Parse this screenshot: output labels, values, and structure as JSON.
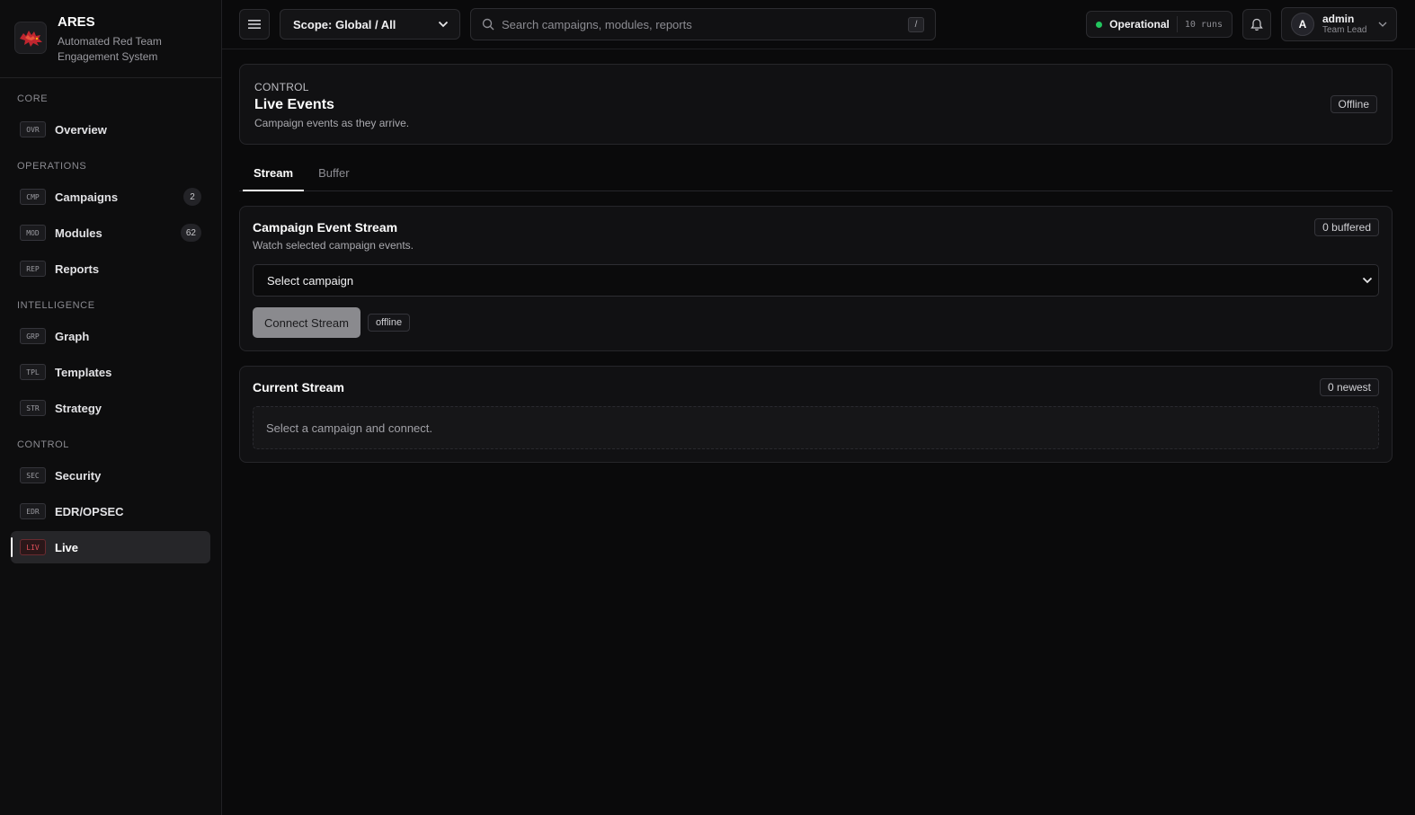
{
  "brand": {
    "name": "ARES",
    "subtitle_line1": "Automated Red Team",
    "subtitle_line2": "Engagement System"
  },
  "sidebar": {
    "sections": [
      {
        "title": "CORE",
        "items": [
          {
            "code": "OVR",
            "label": "Overview"
          }
        ]
      },
      {
        "title": "OPERATIONS",
        "items": [
          {
            "code": "CMP",
            "label": "Campaigns",
            "count": "2"
          },
          {
            "code": "MOD",
            "label": "Modules",
            "count": "62"
          },
          {
            "code": "REP",
            "label": "Reports"
          }
        ]
      },
      {
        "title": "INTELLIGENCE",
        "items": [
          {
            "code": "GRP",
            "label": "Graph"
          },
          {
            "code": "TPL",
            "label": "Templates"
          },
          {
            "code": "STR",
            "label": "Strategy"
          }
        ]
      },
      {
        "title": "CONTROL",
        "items": [
          {
            "code": "SEC",
            "label": "Security"
          },
          {
            "code": "EDR",
            "label": "EDR/OPSEC"
          },
          {
            "code": "LIV",
            "label": "Live",
            "active": true
          }
        ]
      }
    ]
  },
  "topbar": {
    "scope_label": "Scope: Global / All",
    "search_placeholder": "Search campaigns, modules, reports",
    "search_shortcut": "/",
    "status_label": "Operational",
    "status_runs": "10 runs",
    "user_initial": "A",
    "user_name": "admin",
    "user_role": "Team Lead"
  },
  "page": {
    "eyebrow": "CONTROL",
    "title": "Live Events",
    "description": "Campaign events as they arrive.",
    "status_badge": "Offline"
  },
  "tabs": [
    {
      "label": "Stream",
      "active": true
    },
    {
      "label": "Buffer",
      "active": false
    }
  ],
  "event_stream": {
    "title": "Campaign Event Stream",
    "description": "Watch selected campaign events.",
    "badge": "0 buffered",
    "select_value": "Select campaign",
    "connect_label": "Connect Stream",
    "connection_state": "offline"
  },
  "current_stream": {
    "title": "Current Stream",
    "badge": "0 newest",
    "empty_message": "Select a campaign and connect."
  },
  "colors": {
    "background": "#0a0a0b",
    "panel": "#111113",
    "status_ok": "#22c55e",
    "active_code": "#e0505a"
  }
}
